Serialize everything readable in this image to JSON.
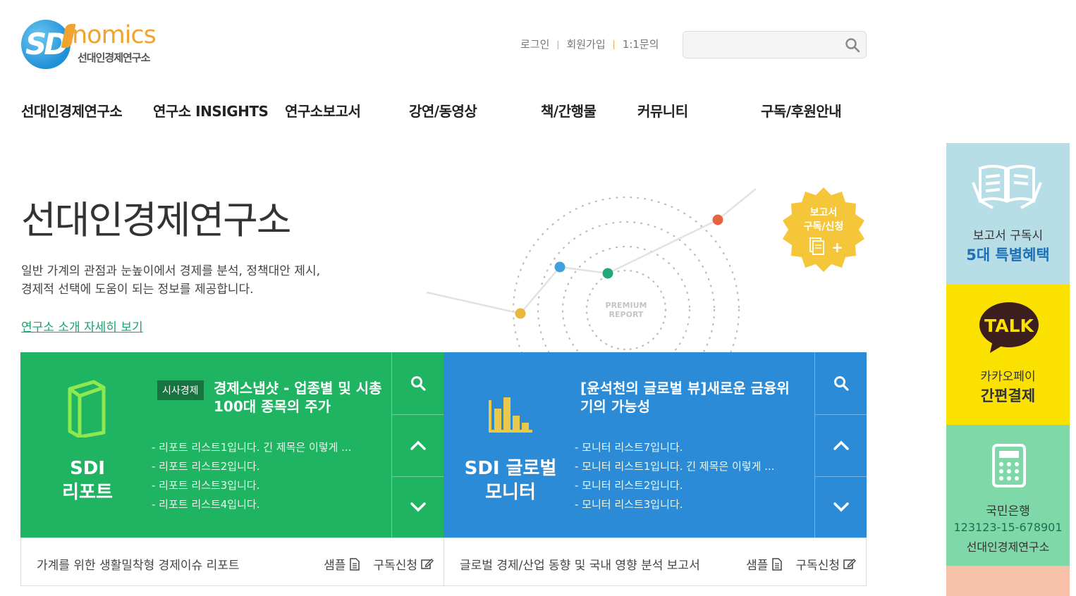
{
  "logo": {
    "sd": "SD",
    "word": "nomics",
    "sub": "선대인경제연구소"
  },
  "util": {
    "login": "로그인",
    "signup": "회원가입",
    "inquiry": "1:1문의",
    "search_placeholder": ""
  },
  "nav": [
    "선대인경제연구소",
    "연구소 INSIGHTS",
    "연구소보고서",
    "강연/동영상",
    "책/간행물",
    "커뮤니티",
    "구독/후원안내"
  ],
  "hero": {
    "title": "선대인경제연구소",
    "desc": "일반 가계의 관점과 눈높이에서 경제를 분석, 정책대안 제시,\n경제적 선택에 도움이 되는 정보를 제공합니다.",
    "link": "연구소 소개 자세히 보기",
    "graphic_label_1": "PREMIUM",
    "graphic_label_2": "REPORT",
    "badge_line1": "보고서",
    "badge_line2": "구독/신청",
    "badge_plus": "+"
  },
  "cards": {
    "green": {
      "name": "SDI\n리포트",
      "tag": "시사경제",
      "title": "경제스냅샷 - 업종별 및 시총 100대 종목의 주가",
      "items": [
        "- 리포트 리스트1입니다. 긴 제목은 이렇게 ...",
        "- 리포트 리스트2입니다.",
        "- 리포트 리스트3입니다.",
        "- 리포트 리스트4입니다."
      ],
      "footer": "가계를 위한 생활밀착형 경제이슈 리포트",
      "sample": "샘플",
      "subscribe": "구독신청"
    },
    "blue": {
      "name": "SDI 글로벌\n모니터",
      "title": "[윤석천의 글로벌 뷰]새로운 금융위기의 가능성",
      "items": [
        "- 모니터 리스트7입니다.",
        "- 모니터 리스트1입니다. 긴 제목은 이렇게 ...",
        "- 모니터 리스트2입니다.",
        "- 모니터 리스트3입니다."
      ],
      "footer": "글로벌 경제/산업 동향 및 국내 영향 분석 보고서",
      "sample": "샘플",
      "subscribe": "구독신청"
    }
  },
  "side": {
    "report": {
      "line1": "보고서 구독시",
      "line2": "5대 특별혜택",
      "bg": "#b7dde6",
      "accent": "#1d6fb8"
    },
    "kakao": {
      "talk": "TALK",
      "line1": "카카오페이",
      "line2": "간편결제",
      "bg": "#fbe100"
    },
    "bank": {
      "line1": "국민은행",
      "line2": "123123-15-678901",
      "line3": "선대인경제연구소",
      "bg": "#7fd8a8"
    }
  },
  "colors": {
    "green": "#1fb462",
    "blue": "#2b8bd6",
    "orange": "#f0a430",
    "badge": "#f6c63a"
  }
}
